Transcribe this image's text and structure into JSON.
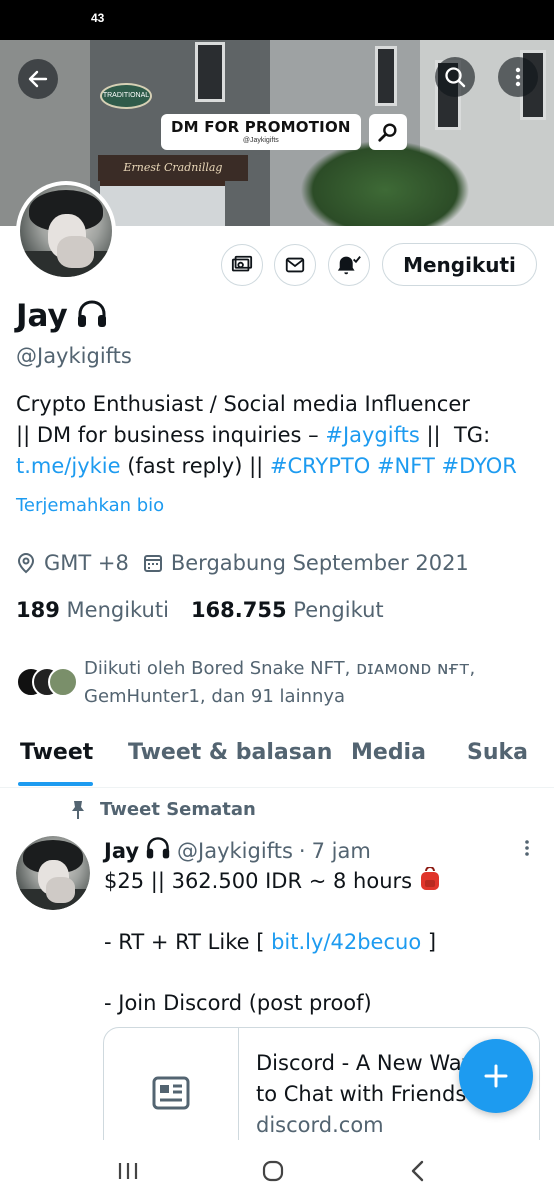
{
  "status_bar": {
    "time": "43"
  },
  "banner": {
    "promo_title": "DM FOR PROMOTION",
    "promo_sub": "@Jaykigifts",
    "shop_sign": "Ernest Cradnillag",
    "oval_sign": "TRADITIONAL",
    "icons": [
      "back-arrow-icon",
      "search-icon",
      "more-vertical-icon",
      "search-icon"
    ]
  },
  "profile": {
    "name": "Jay",
    "name_emoji": "🎧",
    "handle": "@Jaykigifts",
    "follow_label": "Mengikuti",
    "bio": {
      "line1": "Crypto Enthusiast / Social media Influencer",
      "line2_a": "|| DM for business inquiries – ",
      "hashtag_jaygifts": "#Jaygifts",
      "line2_b": " ||  TG:",
      "tg_link": "t.me/jykie",
      "line3_a": " (fast reply) || ",
      "hashtag_crypto": "#CRYPTO",
      "hashtag_nft": "#NFT",
      "hashtag_dyor": "#DYOR"
    },
    "translate_label": "Terjemahkan bio",
    "location": "GMT +8",
    "joined": "Bergabung September 2021",
    "following_count": "189",
    "following_label": "Mengikuti",
    "followers_count": "168.755",
    "followers_label": "Pengikut",
    "followed_by_line1": "Diikuti oleh Bored Snake NFT, ᴅɪᴀᴍᴏɴᴅ ɴғᴛ,",
    "followed_by_line2": "GemHunter1, dan 91 lainnya"
  },
  "tabs": [
    {
      "label": "Tweet",
      "active": true
    },
    {
      "label": "Tweet & balasan",
      "active": false
    },
    {
      "label": "Media",
      "active": false
    },
    {
      "label": "Suka",
      "active": false
    }
  ],
  "pinned_tweet": {
    "pinned_label": "Tweet Sematan",
    "author_name": "Jay",
    "author_emoji": "🎧",
    "author_handle": "@Jaykigifts",
    "dot": "·",
    "time_ago": "7 jam",
    "line1": "$25 || 362.500 IDR ~ 8 hours",
    "line1_emoji": "🎒",
    "line3_a": "- RT + RT Like [ ",
    "line3_link": "bit.ly/42becuo",
    "line3_b": " ]",
    "line5": "- Join Discord (post proof)",
    "card_title_1": "Discord - A New Way",
    "card_title_2": "to Chat with Friends",
    "card_domain": "discord.com"
  },
  "colors": {
    "accent": "#1d9bf0",
    "text_primary": "#0f1419",
    "text_secondary": "#536471",
    "border": "#cfd9de"
  }
}
